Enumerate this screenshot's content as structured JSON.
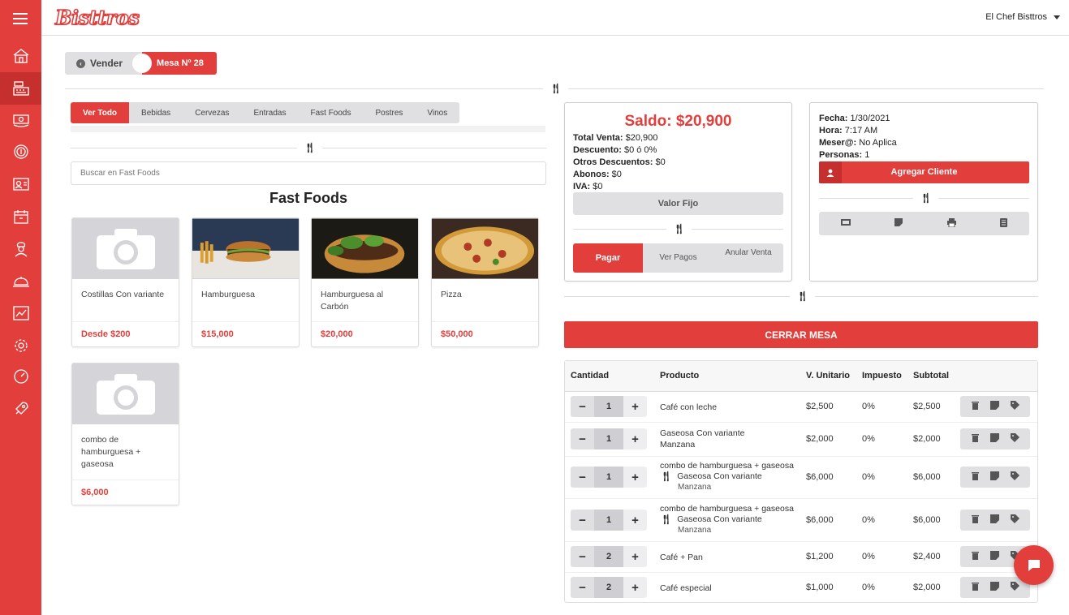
{
  "brand": {
    "logo_text": "Bisttros",
    "accent": "#e23e3c"
  },
  "user": {
    "name": "El Chef Bisttros"
  },
  "breadcrumb": {
    "back_label": "Vender",
    "current_label": "Mesa Nº 28"
  },
  "sidebar": {
    "items": [
      {
        "icon": "home-icon"
      },
      {
        "icon": "cash-register-icon",
        "active": true
      },
      {
        "icon": "money-icon"
      },
      {
        "icon": "coins-icon"
      },
      {
        "icon": "contacts-card-icon"
      },
      {
        "icon": "calendar-icon"
      },
      {
        "icon": "chef-icon"
      },
      {
        "icon": "food-tray-icon"
      },
      {
        "icon": "chart-icon"
      },
      {
        "icon": "gear-icon"
      },
      {
        "icon": "speedometer-icon"
      },
      {
        "icon": "rocket-icon"
      }
    ]
  },
  "categories": [
    "Ver Todo",
    "Bebidas",
    "Cervezas",
    "Entradas",
    "Fast Foods",
    "Postres",
    "Vinos"
  ],
  "search": {
    "placeholder": "Buscar en Fast Foods"
  },
  "section_title": "Fast Foods",
  "products": [
    {
      "name": "Costillas Con variante",
      "price": "Desde $200",
      "image": "placeholder-camera"
    },
    {
      "name": "Hamburguesa",
      "price": "$15,000",
      "image": "burger-fries-photo"
    },
    {
      "name": "Hamburguesa al Carbón",
      "price": "$20,000",
      "image": "burger-basil-photo"
    },
    {
      "name": "Pizza",
      "price": "$50,000",
      "image": "pizza-photo"
    },
    {
      "name": "combo de hamburguesa + gaseosa",
      "price": "$6,000",
      "image": "placeholder-camera"
    }
  ],
  "summary": {
    "saldo": "Saldo: $20,900",
    "total_venta_label": "Total Venta:",
    "total_venta": "$20,900",
    "descuento_label": "Descuento:",
    "descuento": "$0 ó 0%",
    "otros_label": "Otros Descuentos:",
    "otros": "$0",
    "abonos_label": "Abonos:",
    "abonos": "$0",
    "iva_label": "IVA:",
    "iva": "$0",
    "valor_fijo": "Valor Fijo",
    "pagar": "Pagar",
    "ver_pagos": "Ver Pagos",
    "anular_venta": "Anular Venta"
  },
  "info": {
    "fecha_label": "Fecha:",
    "fecha": "1/30/2021",
    "hora_label": "Hora:",
    "hora": "7:17 AM",
    "mesero_label": "Meser@:",
    "mesero": "No Aplica",
    "personas_label": "Personas:",
    "personas": "1",
    "agregar_cliente": "Agregar Cliente"
  },
  "cerrar_mesa": "CERRAR MESA",
  "order_table": {
    "headers": [
      "Cantidad",
      "Producto",
      "V. Unitario",
      "Impuesto",
      "Subtotal"
    ],
    "rows": [
      {
        "qty": "1",
        "product": "Café con leche",
        "unit": "$2,500",
        "tax": "0%",
        "subtotal": "$2,500"
      },
      {
        "qty": "1",
        "product": "Gaseosa Con variante",
        "variant": "Manzana",
        "unit": "$2,000",
        "tax": "0%",
        "subtotal": "$2,000"
      },
      {
        "qty": "1",
        "product": "combo de hamburguesa + gaseosa",
        "sub_item": "Gaseosa Con variante",
        "sub_variant": "Manzana",
        "unit": "$6,000",
        "tax": "0%",
        "subtotal": "$6,000"
      },
      {
        "qty": "1",
        "product": "combo de hamburguesa + gaseosa",
        "sub_item": "Gaseosa Con variante",
        "sub_variant": "Manzana",
        "unit": "$6,000",
        "tax": "0%",
        "subtotal": "$6,000"
      },
      {
        "qty": "2",
        "product": "Café + Pan",
        "unit": "$1,200",
        "tax": "0%",
        "subtotal": "$2,400"
      },
      {
        "qty": "2",
        "product": "Café especial",
        "unit": "$1,000",
        "tax": "0%",
        "subtotal": "$2,000"
      }
    ]
  }
}
